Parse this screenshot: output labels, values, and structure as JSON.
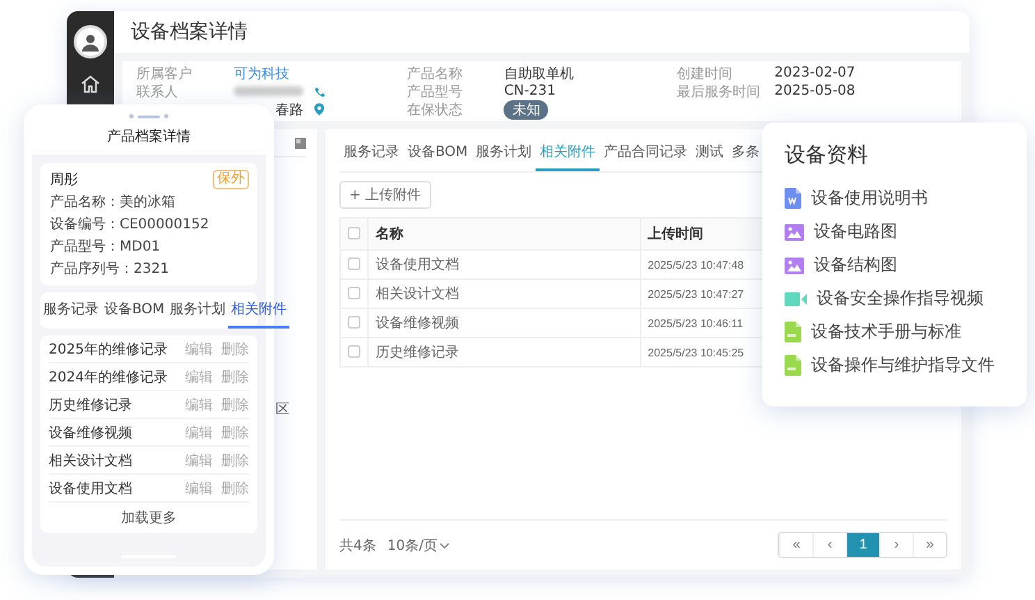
{
  "desktop": {
    "title": "设备档案详情",
    "info": [
      {
        "label": "所属客户",
        "value": "可为科技",
        "kind": "link"
      },
      {
        "label": "联系人",
        "kind": "blurred_phone"
      },
      {
        "value": "春路",
        "kind": "address"
      },
      {
        "label": "产品名称",
        "value": "自助取单机",
        "kind": "text"
      },
      {
        "label": "产品型号",
        "value": "CN-231",
        "kind": "text"
      },
      {
        "label": "在保状态",
        "value": "未知",
        "kind": "badge"
      },
      {
        "label": "创建时间",
        "value": "2023-02-07",
        "kind": "text"
      },
      {
        "label": "最后服务时间",
        "value": "2025-05-08",
        "kind": "text"
      }
    ],
    "tree": {
      "items": [
        "区"
      ]
    },
    "tabs": [
      {
        "label": "服务记录",
        "selected": false
      },
      {
        "label": "设备BOM",
        "selected": false
      },
      {
        "label": "服务计划",
        "selected": false
      },
      {
        "label": "相关附件",
        "selected": true
      },
      {
        "label": "产品合同记录",
        "selected": false
      },
      {
        "label": "测试",
        "selected": false
      },
      {
        "label": "多条",
        "selected": false
      }
    ],
    "upload_button": "+ 上传附件",
    "table": {
      "select_all_checked": false,
      "columns": [
        "名称",
        "上传时间"
      ],
      "rows": [
        {
          "checked": false,
          "cells": [
            "设备使用文档",
            "2025/5/23 10:47:48"
          ]
        },
        {
          "checked": false,
          "cells": [
            "相关设计文档",
            "2025/5/23 10:47:27"
          ]
        },
        {
          "checked": false,
          "cells": [
            "设备维修视频",
            "2025/5/23 10:46:11"
          ]
        },
        {
          "checked": false,
          "cells": [
            "历史维修记录",
            "2025/5/23 10:45:25"
          ]
        }
      ]
    },
    "footer": {
      "total": "共4条",
      "page_size": "10条/页"
    },
    "pagination": [
      {
        "label": "«",
        "selected": false
      },
      {
        "label": "‹",
        "selected": false
      },
      {
        "label": "1",
        "selected": true
      },
      {
        "label": "›",
        "selected": false
      },
      {
        "label": "»",
        "selected": false
      }
    ]
  },
  "phone": {
    "title": "产品档案详情",
    "card": {
      "name": "周彤",
      "badge": "保外",
      "fields": [
        "产品名称：美的冰箱",
        "设备编号：CE00000152",
        "产品型号：MD01",
        "产品序列号：2321"
      ]
    },
    "tabs": [
      {
        "label": "服务记录",
        "selected": false
      },
      {
        "label": "设备BOM",
        "selected": false
      },
      {
        "label": "服务计划",
        "selected": false
      },
      {
        "label": "相关附件",
        "selected": true
      }
    ],
    "rows": [
      {
        "name": "2025年的维修记录",
        "actions": [
          "编辑",
          "删除"
        ]
      },
      {
        "name": "2024年的维修记录",
        "actions": [
          "编辑",
          "删除"
        ]
      },
      {
        "name": "历史维修记录",
        "actions": [
          "编辑",
          "删除"
        ]
      },
      {
        "name": "设备维修视频",
        "actions": [
          "编辑",
          "删除"
        ]
      },
      {
        "name": "相关设计文档",
        "actions": [
          "编辑",
          "删除"
        ]
      },
      {
        "name": "设备使用文档",
        "actions": [
          "编辑",
          "删除"
        ]
      }
    ],
    "load_more": "加载更多"
  },
  "resources": {
    "title": "设备资料",
    "items": [
      {
        "kind": "word",
        "label": "设备使用说明书"
      },
      {
        "kind": "image",
        "label": "设备电路图"
      },
      {
        "kind": "image",
        "label": "设备结构图"
      },
      {
        "kind": "video",
        "label": "设备安全操作指导视频"
      },
      {
        "kind": "pdf",
        "label": "设备技术手册与标准"
      },
      {
        "kind": "pdf",
        "label": "设备操作与维护指导文件"
      }
    ]
  }
}
